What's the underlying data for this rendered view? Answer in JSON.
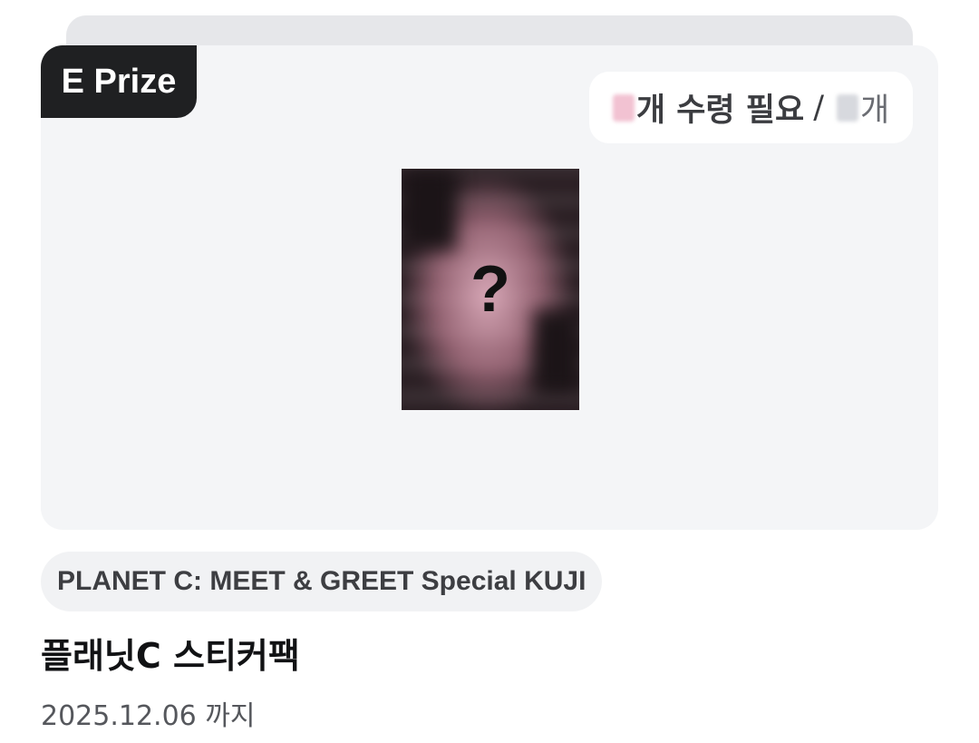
{
  "prize": {
    "grade": "E Prize",
    "count_pill": {
      "need_label": "개 수령 필요",
      "separator": "/",
      "total_unit": "개"
    },
    "image": {
      "placeholder": "?"
    },
    "lineup": "PLANET C: MEET & GREET Special KUJI",
    "title": "플래닛C 스티커팩",
    "deadline": "2025.12.06 까지"
  },
  "colors": {
    "grade_tag_bg": "#1f2022",
    "card_bg": "#f4f5f7",
    "chip_bg": "#f1f2f4"
  }
}
